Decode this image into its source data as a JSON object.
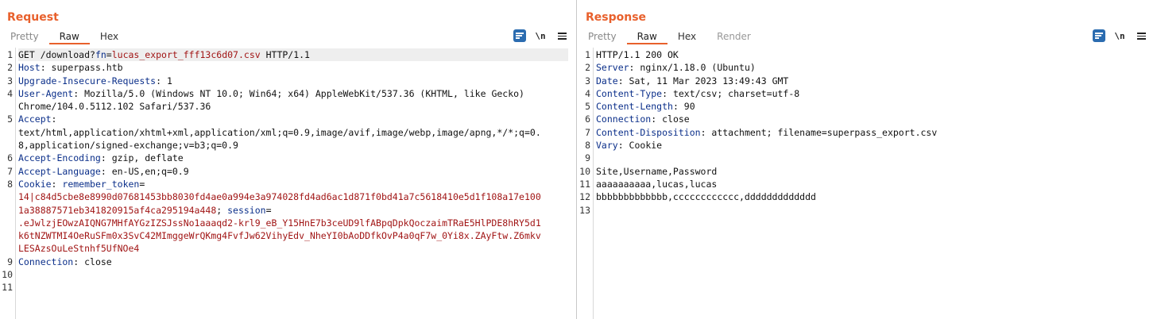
{
  "request": {
    "title": "Request",
    "tabs": [
      "Pretty",
      "Raw",
      "Hex"
    ],
    "active_tab": "Raw",
    "line_numbers": [
      "1",
      "2",
      "3",
      "4",
      "",
      "5",
      "",
      "",
      "6",
      "7",
      "8",
      "",
      "",
      "",
      "",
      "",
      "9",
      "10",
      "11"
    ],
    "lines": [
      {
        "parts": [
          {
            "t": "GET /download?",
            "c": ""
          },
          {
            "t": "fn",
            "c": "k"
          },
          {
            "t": "=",
            "c": ""
          },
          {
            "t": "lucas_export_fff13c6d07.csv",
            "c": "p"
          },
          {
            "t": " HTTP/1.1",
            "c": ""
          }
        ],
        "highlight": true
      },
      {
        "parts": [
          {
            "t": "Host",
            "c": "k"
          },
          {
            "t": ": superpass.htb",
            "c": ""
          }
        ]
      },
      {
        "parts": [
          {
            "t": "Upgrade-Insecure-Requests",
            "c": "k"
          },
          {
            "t": ": 1",
            "c": ""
          }
        ]
      },
      {
        "parts": [
          {
            "t": "User-Agent",
            "c": "k"
          },
          {
            "t": ": Mozilla/5.0 (Windows NT 10.0; Win64; x64) AppleWebKit/537.36 (KHTML, like Gecko)",
            "c": ""
          }
        ]
      },
      {
        "parts": [
          {
            "t": "Chrome/104.0.5112.102 Safari/537.36",
            "c": ""
          }
        ]
      },
      {
        "parts": [
          {
            "t": "Accept",
            "c": "k"
          },
          {
            "t": ":",
            "c": ""
          }
        ]
      },
      {
        "parts": [
          {
            "t": "text/html,application/xhtml+xml,application/xml;q=0.9,image/avif,image/webp,image/apng,*/*;q=0.",
            "c": ""
          }
        ]
      },
      {
        "parts": [
          {
            "t": "8,application/signed-exchange;v=b3;q=0.9",
            "c": ""
          }
        ]
      },
      {
        "parts": [
          {
            "t": "Accept-Encoding",
            "c": "k"
          },
          {
            "t": ": gzip, deflate",
            "c": ""
          }
        ]
      },
      {
        "parts": [
          {
            "t": "Accept-Language",
            "c": "k"
          },
          {
            "t": ": en-US,en;q=0.9",
            "c": ""
          }
        ]
      },
      {
        "parts": [
          {
            "t": "Cookie",
            "c": "k"
          },
          {
            "t": ": ",
            "c": ""
          },
          {
            "t": "remember_token",
            "c": "k"
          },
          {
            "t": "=",
            "c": ""
          }
        ]
      },
      {
        "parts": [
          {
            "t": "14|c84d5cbe8e8990d07681453bb8030fd4ae0a994e3a974028fd4ad6ac1d871f0bd41a7c5618410e5d1f108a17e100",
            "c": "p"
          }
        ]
      },
      {
        "parts": [
          {
            "t": "1a38887571eb341820915af4ca295194a448",
            "c": "p"
          },
          {
            "t": "; ",
            "c": ""
          },
          {
            "t": "session",
            "c": "k"
          },
          {
            "t": "=",
            "c": ""
          }
        ]
      },
      {
        "parts": [
          {
            "t": ".eJwlzjEOwzAIQNG7MHfAYGzIZSJssNo1aaaqd2-krl9_eB_Y15HnE7b3ceUD9lfABpqDpkQoczaimTRaE5HlPDE8hRY5d1",
            "c": "p"
          }
        ]
      },
      {
        "parts": [
          {
            "t": "k6tNZWTMI4OeRuSFm0x3SvC42MImggeWrQKmg4FvfJw62VihyEdv_NheYI0bAoDDfkOvP4a0qF7w_0Yi8x.ZAyFtw.Z6mkv",
            "c": "p"
          }
        ]
      },
      {
        "parts": [
          {
            "t": "LESAzsOuLeStnhf5UfNOe4",
            "c": "p"
          }
        ]
      },
      {
        "parts": [
          {
            "t": "Connection",
            "c": "k"
          },
          {
            "t": ": close",
            "c": ""
          }
        ]
      },
      {
        "parts": [
          {
            "t": "",
            "c": ""
          }
        ]
      },
      {
        "parts": [
          {
            "t": "",
            "c": ""
          }
        ]
      }
    ]
  },
  "response": {
    "title": "Response",
    "tabs": [
      "Pretty",
      "Raw",
      "Hex",
      "Render"
    ],
    "active_tab": "Raw",
    "line_numbers": [
      "1",
      "2",
      "3",
      "4",
      "5",
      "6",
      "7",
      "8",
      "9",
      "10",
      "11",
      "12",
      "13"
    ],
    "lines": [
      {
        "parts": [
          {
            "t": "HTTP/1.1 200 OK",
            "c": ""
          }
        ]
      },
      {
        "parts": [
          {
            "t": "Server",
            "c": "k"
          },
          {
            "t": ": nginx/1.18.0 (Ubuntu)",
            "c": ""
          }
        ]
      },
      {
        "parts": [
          {
            "t": "Date",
            "c": "k"
          },
          {
            "t": ": Sat, 11 Mar 2023 13:49:43 GMT",
            "c": ""
          }
        ]
      },
      {
        "parts": [
          {
            "t": "Content-Type",
            "c": "k"
          },
          {
            "t": ": text/csv; charset=utf-8",
            "c": ""
          }
        ]
      },
      {
        "parts": [
          {
            "t": "Content-Length",
            "c": "k"
          },
          {
            "t": ": 90",
            "c": ""
          }
        ]
      },
      {
        "parts": [
          {
            "t": "Connection",
            "c": "k"
          },
          {
            "t": ": close",
            "c": ""
          }
        ]
      },
      {
        "parts": [
          {
            "t": "Content-Disposition",
            "c": "k"
          },
          {
            "t": ": attachment; filename=superpass_export.csv",
            "c": ""
          }
        ]
      },
      {
        "parts": [
          {
            "t": "Vary",
            "c": "k"
          },
          {
            "t": ": Cookie",
            "c": ""
          }
        ]
      },
      {
        "parts": [
          {
            "t": "",
            "c": ""
          }
        ]
      },
      {
        "parts": [
          {
            "t": "Site,Username,Password",
            "c": ""
          }
        ]
      },
      {
        "parts": [
          {
            "t": "aaaaaaaaaa,lucas,lucas",
            "c": ""
          }
        ]
      },
      {
        "parts": [
          {
            "t": "bbbbbbbbbbbbb,cccccccccccc,ddddddddddddd",
            "c": ""
          }
        ]
      },
      {
        "parts": [
          {
            "t": "",
            "c": ""
          }
        ]
      }
    ]
  },
  "toolbar": {
    "newline_label": "\\n"
  },
  "colors": {
    "accent": "#e8602c",
    "header_key": "#0b2f8a",
    "param_value": "#a11515",
    "button_blue": "#1f5fa8"
  },
  "icons": [
    "wrap-lines-icon",
    "newline-icon",
    "menu-icon",
    "layout-side-by-side-icon",
    "layout-top-bottom-icon",
    "layout-tabs-icon"
  ]
}
